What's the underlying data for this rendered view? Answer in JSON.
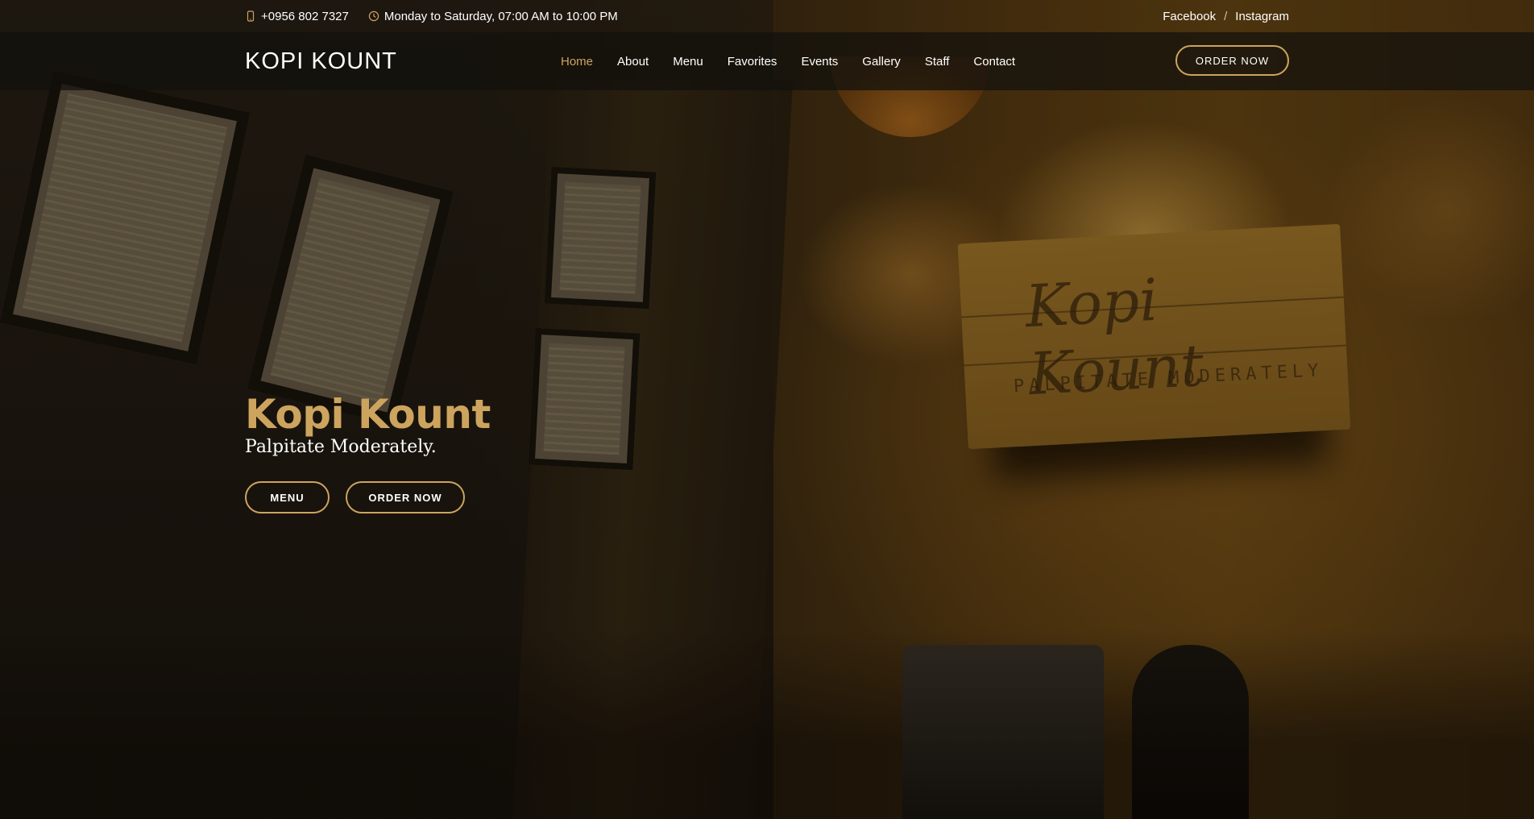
{
  "topbar": {
    "phone": "+0956 802 7327",
    "hours": "Monday to Saturday, 07:00 AM to 10:00 PM",
    "social": [
      {
        "label": "Facebook"
      },
      {
        "label": "Instagram"
      }
    ],
    "separator": "/",
    "icons": {
      "phone": "phone-icon",
      "hours": "clock-icon"
    }
  },
  "header": {
    "logo": "KOPI KOUNT",
    "nav": [
      {
        "label": "Home",
        "active": true
      },
      {
        "label": "About"
      },
      {
        "label": "Menu"
      },
      {
        "label": "Favorites"
      },
      {
        "label": "Events"
      },
      {
        "label": "Gallery"
      },
      {
        "label": "Staff"
      },
      {
        "label": "Contact"
      }
    ],
    "order_label": "ORDER NOW"
  },
  "hero": {
    "title": "Kopi Kount",
    "tagline": "Palpitate Moderately.",
    "menu_label": "MENU",
    "order_label": "ORDER NOW",
    "sign_text": "Kopi Kount",
    "sign_subtext": "PALPITATE MODERATELY"
  },
  "colors": {
    "accent": "#cda45e",
    "header_bg": "rgba(18,16,12,0.72)"
  }
}
